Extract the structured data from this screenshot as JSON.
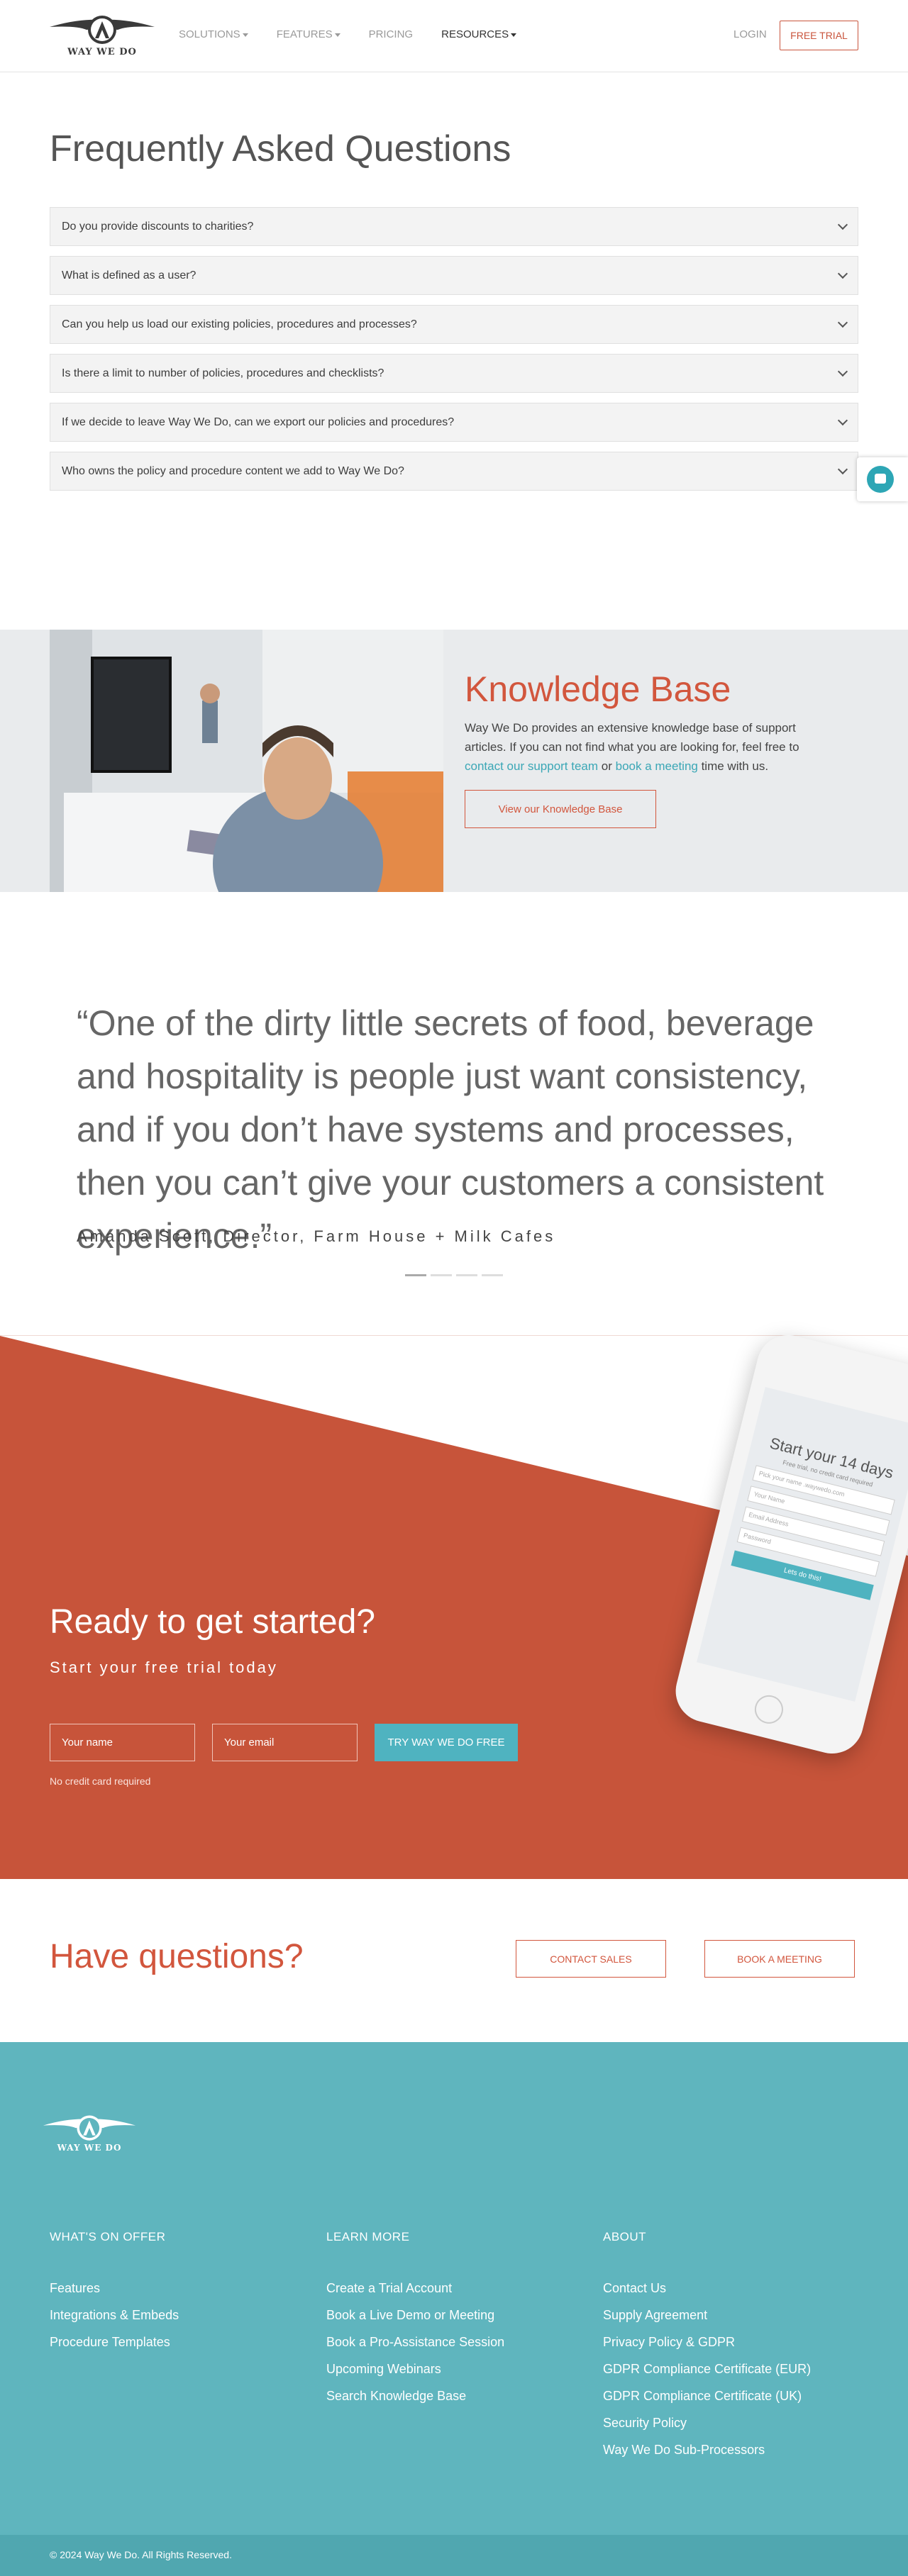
{
  "brand": {
    "name": "WAY WE DO",
    "accent": "#d2563d",
    "teal": "#5fb5be"
  },
  "nav": {
    "items": [
      {
        "label": "SOLUTIONS",
        "dropdown": true
      },
      {
        "label": "FEATURES",
        "dropdown": true
      },
      {
        "label": "PRICING",
        "dropdown": false
      },
      {
        "label": "RESOURCES",
        "dropdown": true
      }
    ],
    "login": "LOGIN",
    "trial": "FREE TRIAL"
  },
  "faq": {
    "title": "Frequently Asked Questions",
    "items": [
      "Do you provide discounts to charities?",
      "What is defined as a user?",
      "Can you help us load our existing policies, procedures and processes?",
      "Is there a limit to number of policies, procedures and checklists?",
      "If we decide to leave Way We Do, can we export our policies and procedures?",
      "Who owns the policy and procedure content we add to Way We Do?"
    ]
  },
  "kb": {
    "title": "Knowledge Base",
    "text_1": "Way We Do provides an extensive knowledge base of support articles.  If you can not find what you are looking for, feel free to ",
    "link_1": "contact our support team",
    "text_2": " or ",
    "link_2": "book a meeting",
    "text_3": " time with us.",
    "button": "View our Knowledge Base"
  },
  "quote": {
    "text": "“One of the dirty little secrets of food, beverage and hospitality is people just want consistency, and if you don’t have systems and processes, then you can’t give your customers a consistent experience.”",
    "author": "Amanda Scott, Director, Farm House + Milk Cafes"
  },
  "cta": {
    "title": "Ready to get started?",
    "subtitle": "Start your free trial today",
    "name_placeholder": "Your name",
    "email_placeholder": "Your email",
    "button": "TRY WAY WE DO FREE",
    "note": "No credit card required",
    "phone": {
      "heading": "Start your 14 days",
      "sub": "Free trial, no credit card required",
      "fields": [
        "Pick your name  .waywedo.com",
        "Your Name",
        "Email Address",
        "Password"
      ],
      "button": "Lets do this!"
    }
  },
  "questions": {
    "title": "Have questions?",
    "contact_sales": "CONTACT SALES",
    "book_meeting": "BOOK A MEETING"
  },
  "footer": {
    "columns": [
      {
        "heading": "WHAT'S ON OFFER",
        "items": [
          "Features",
          "Integrations & Embeds",
          "Procedure Templates"
        ]
      },
      {
        "heading": "LEARN MORE",
        "items": [
          "Create a Trial Account",
          "Book a Live Demo or Meeting",
          "Book a Pro-Assistance Session",
          "Upcoming Webinars",
          "Search Knowledge Base"
        ]
      },
      {
        "heading": "ABOUT",
        "items": [
          "Contact Us",
          "Supply Agreement",
          "Privacy Policy & GDPR",
          "GDPR Compliance Certificate (EUR)",
          "GDPR Compliance Certificate (UK)",
          "Security Policy",
          "Way We Do Sub-Processors"
        ]
      }
    ],
    "copyright": "© 2024 Way We Do. All Rights Reserved."
  }
}
